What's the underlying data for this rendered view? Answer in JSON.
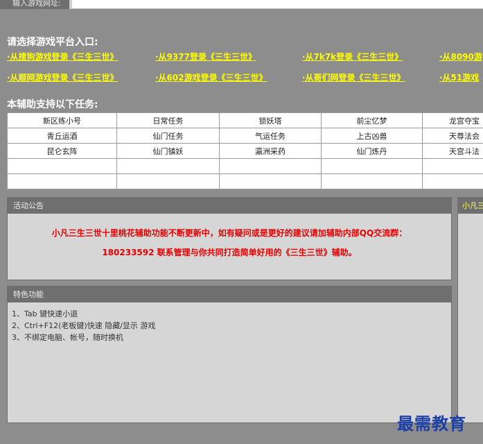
{
  "top_bar": {
    "url_label": "输入游戏网址:",
    "url_value": ""
  },
  "platform_section": {
    "title": "请选择游戏平台入口:",
    "links": [
      "·从搜狗游戏登录《三生三世》",
      "·从9377登录《三生三世》",
      "·从7k7k登录《三生三世》",
      "·从8090游",
      "·从顺网游戏登录《三生三世》",
      "·从602游戏登录《三生三世》",
      "·从哥们网登录《三生三世》",
      "·从51游戏"
    ]
  },
  "tasks_section": {
    "title": "本辅助支持以下任务:",
    "rows": [
      [
        "新区练小号",
        "日常任务",
        "锁妖塔",
        "前尘忆梦",
        "龙宫夺宝"
      ],
      [
        "青丘运酒",
        "仙门任务",
        "气运任务",
        "上古凶兽",
        "天尊法会"
      ],
      [
        "昆仑玄阵",
        "仙门镇妖",
        "瀛洲采药",
        "仙门炼丹",
        "天宫斗法"
      ],
      [
        "",
        "",
        "",
        "",
        ""
      ],
      [
        "",
        "",
        "",
        "",
        ""
      ]
    ]
  },
  "announcement": {
    "header": "活动公告",
    "line1": "小凡三生三世十里桃花辅助功能不断更新中，如有疑问或是更好的建议请加辅助内部QQ交流群：",
    "line2": "180233592 联系管理与你共同打造简单好用的《三生三世》辅助。"
  },
  "features": {
    "header": "特色功能",
    "items": [
      "1、Tab 键快速小退",
      "2、Ctrl+F12(老板键)快速 隐藏/显示 游戏",
      "3、不绑定电脑、帐号，随时换机"
    ]
  },
  "side_panel": {
    "header": "小凡三生"
  },
  "watermark": "最需教育",
  "colors": {
    "background": "#8d8d8d",
    "link": "#ffff00",
    "announcement_text": "#e60000",
    "panel_header": "#6f6f6f"
  }
}
